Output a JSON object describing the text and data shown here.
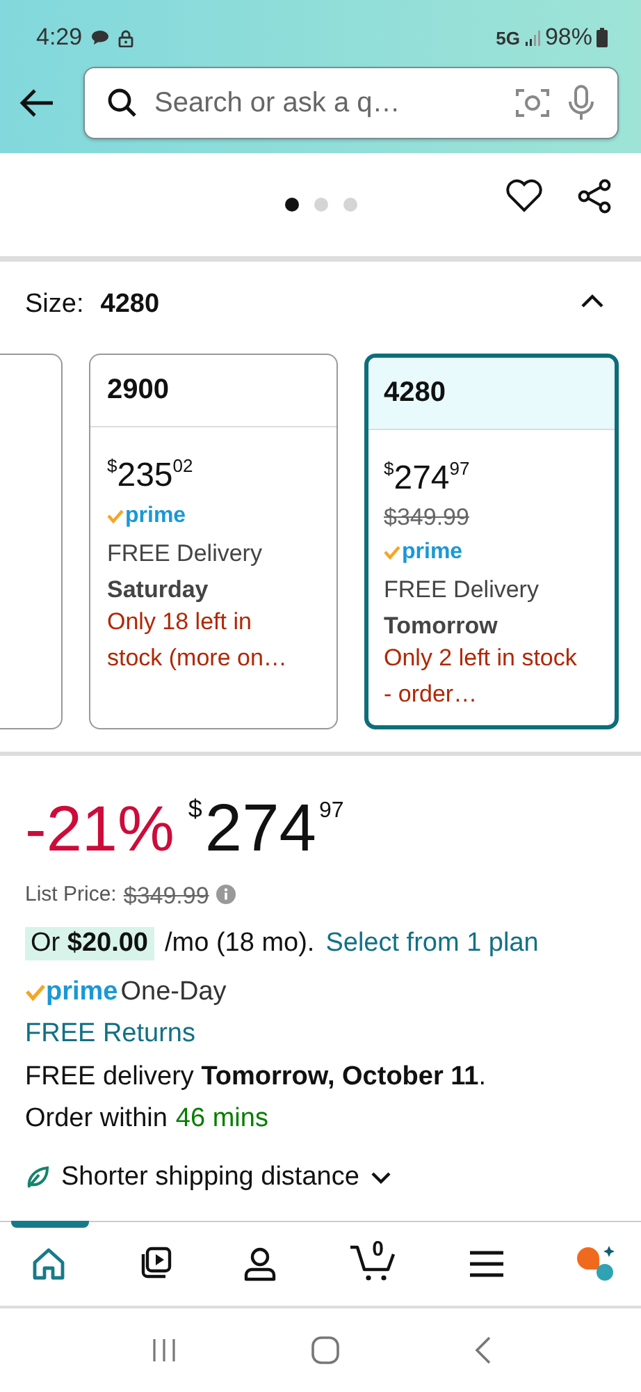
{
  "status_bar": {
    "time": "4:29",
    "network": "5G",
    "battery": "98%"
  },
  "search": {
    "placeholder": "Search or ask a q…"
  },
  "gallery": {
    "dots": [
      {
        "selected": true
      },
      {
        "selected": false
      },
      {
        "selected": false
      }
    ]
  },
  "size": {
    "label": "Size:",
    "value": "4280",
    "expanded": true
  },
  "size_options": [
    {
      "kind": "partial",
      "selected": false
    },
    {
      "kind": "full",
      "selected": false,
      "label": "2900",
      "currency": "$",
      "price_whole": "235",
      "price_fraction": "02",
      "prime": "prime",
      "delivery": "FREE Delivery",
      "day": "Saturday",
      "stock": "Only 18 left in stock (more on…"
    },
    {
      "kind": "full",
      "selected": true,
      "label": "4280",
      "currency": "$",
      "price_whole": "274",
      "price_fraction": "97",
      "list_price": "$349.99",
      "prime": "prime",
      "delivery": "FREE Delivery",
      "day": "Tomorrow",
      "stock": "Only 2 left in stock - order…"
    }
  ],
  "price": {
    "discount": "-21%",
    "currency": "$",
    "whole": "274",
    "fraction": "97",
    "list_label": "List Price:",
    "list_price": "$349.99"
  },
  "installment": {
    "highlight": "Or **$20.00**",
    "term": "/mo (18 mo).",
    "link": "Select from 1 plan"
  },
  "prime_line": {
    "badge": "prime",
    "text": "One-Day"
  },
  "returns": "FREE Returns",
  "delivery": {
    "text": "FREE delivery **Tomorrow, October 11**.",
    "order_prefix": "Order within",
    "countdown": "46 mins"
  },
  "shipping": {
    "text": "Shorter shipping distance",
    "expanded": false
  },
  "nav": [
    {
      "kind": "home",
      "selected": true
    },
    {
      "kind": "video",
      "selected": false
    },
    {
      "kind": "account",
      "selected": false
    },
    {
      "kind": "cart",
      "selected": false,
      "count": "0"
    },
    {
      "kind": "menu",
      "selected": false
    },
    {
      "kind": "assistant",
      "selected": false
    }
  ]
}
